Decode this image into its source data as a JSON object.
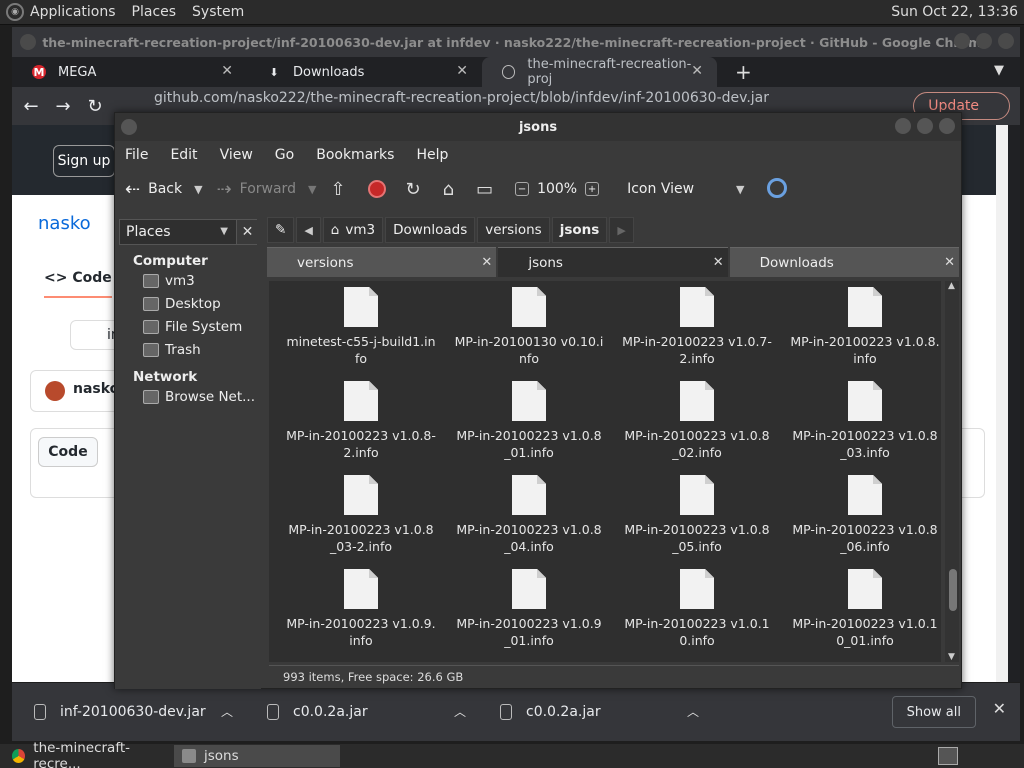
{
  "top_panel": {
    "menus": [
      "Applications",
      "Places",
      "System"
    ],
    "clock": "Sun Oct 22, 13:36"
  },
  "chrome": {
    "title": "the-minecraft-recreation-project/inf-20100630-dev.jar at infdev · nasko222/the-minecraft-recreation-project · GitHub - Google Chrome",
    "tabs": [
      {
        "label": "MEGA",
        "icon": "mega-icon"
      },
      {
        "label": "Downloads",
        "icon": "download-icon"
      },
      {
        "label": "the-minecraft-recreation-proj",
        "icon": "github-icon"
      }
    ],
    "url": "github.com/nasko222/the-minecraft-recreation-project/blob/infdev/inf-20100630-dev.jar",
    "update_label": "Update",
    "page": {
      "signup": "Sign up",
      "repo": "nasko",
      "code_tab": "Code",
      "branch": "in",
      "user": "nasko",
      "code_button": "Code"
    }
  },
  "downloads_bar": {
    "items": [
      "inf-20100630-dev.jar",
      "c0.0.2a.jar",
      "c0.0.2a.jar"
    ],
    "show_all": "Show all"
  },
  "taskbar": {
    "buttons": [
      {
        "label": "the-minecraft-recre...",
        "icon": "chrome-icon"
      },
      {
        "label": "jsons",
        "icon": "folder-icon"
      }
    ]
  },
  "file_manager": {
    "title": "jsons",
    "menu": [
      "File",
      "Edit",
      "View",
      "Go",
      "Bookmarks",
      "Help"
    ],
    "toolbar": {
      "back": "Back",
      "forward": "Forward",
      "zoom": "100%",
      "view": "Icon View"
    },
    "sidebar": {
      "header": "Places",
      "sections": [
        {
          "title": "Computer",
          "items": [
            "vm3",
            "Desktop",
            "File System",
            "Trash"
          ]
        },
        {
          "title": "Network",
          "items": [
            "Browse Net..."
          ]
        }
      ]
    },
    "path": [
      "vm3",
      "Downloads",
      "versions",
      "jsons"
    ],
    "tabs": [
      "versions",
      "jsons",
      "Downloads"
    ],
    "files": [
      "minetest-c55-j-build1.info",
      "MP-in-20100130 v0.10.info",
      "MP-in-20100223 v1.0.7-2.info",
      "MP-in-20100223 v1.0.8.info",
      "MP-in-20100223 v1.0.8-2.info",
      "MP-in-20100223 v1.0.8_01.info",
      "MP-in-20100223 v1.0.8_02.info",
      "MP-in-20100223 v1.0.8_03.info",
      "MP-in-20100223 v1.0.8_03-2.info",
      "MP-in-20100223 v1.0.8_04.info",
      "MP-in-20100223 v1.0.8_05.info",
      "MP-in-20100223 v1.0.8_06.info",
      "MP-in-20100223 v1.0.9.info",
      "MP-in-20100223 v1.0.9_01.info",
      "MP-in-20100223 v1.0.10.info",
      "MP-in-20100223 v1.0.10_01.info"
    ],
    "status": "993 items, Free space: 26.6 GB"
  }
}
